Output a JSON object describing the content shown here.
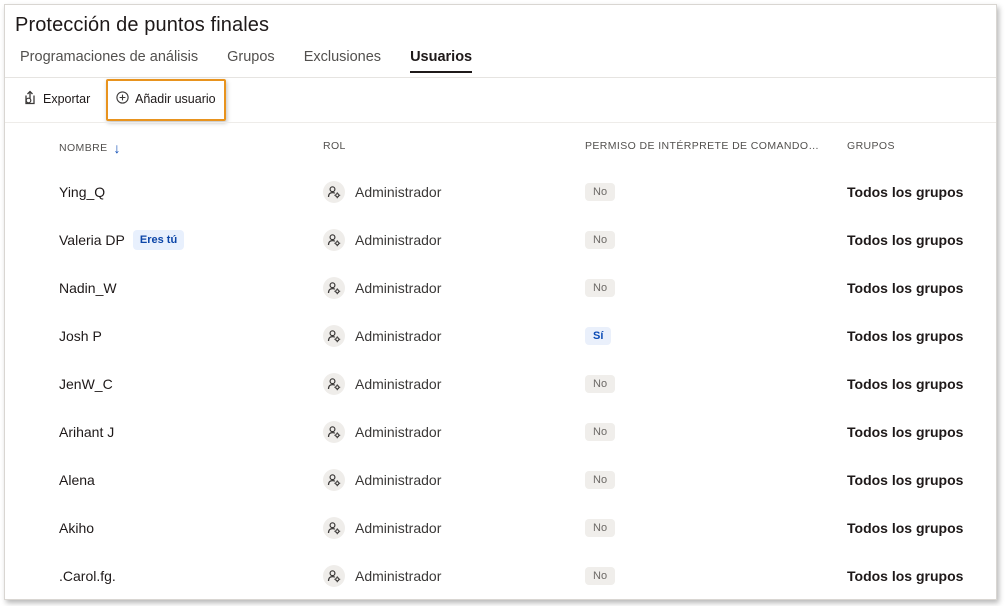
{
  "page": {
    "title": "Protección de puntos finales"
  },
  "tabs": [
    {
      "label": "Programaciones de análisis",
      "active": false
    },
    {
      "label": "Grupos",
      "active": false
    },
    {
      "label": "Exclusiones",
      "active": false
    },
    {
      "label": "Usuarios",
      "active": true
    }
  ],
  "toolbar": {
    "export_label": "Exportar",
    "add_user_label": "Añadir usuario",
    "highlight_color": "#e8931e"
  },
  "table": {
    "columns": {
      "name": "NOMBRE",
      "role": "ROL",
      "permission": "PERMISO DE INTÉRPRETE DE COMANDO…",
      "groups": "GRUPOS"
    },
    "sort_indicator": "↓",
    "rows": [
      {
        "name": "Ying_Q",
        "badge": "",
        "role": "Administrador",
        "permission": "No",
        "groups": "Todos los grupos"
      },
      {
        "name": "Valeria DP",
        "badge": "Eres tú",
        "role": "Administrador",
        "permission": "No",
        "groups": "Todos los grupos"
      },
      {
        "name": "Nadin_W",
        "badge": "",
        "role": "Administrador",
        "permission": "No",
        "groups": "Todos los grupos"
      },
      {
        "name": "Josh P",
        "badge": "",
        "role": "Administrador",
        "permission": "Sí",
        "groups": "Todos los grupos"
      },
      {
        "name": "JenW_C",
        "badge": "",
        "role": "Administrador",
        "permission": "No",
        "groups": "Todos los grupos"
      },
      {
        "name": "Arihant J",
        "badge": "",
        "role": "Administrador",
        "permission": "No",
        "groups": "Todos los grupos"
      },
      {
        "name": "Alena",
        "badge": "",
        "role": "Administrador",
        "permission": "No",
        "groups": "Todos los grupos"
      },
      {
        "name": "Akiho",
        "badge": "",
        "role": "Administrador",
        "permission": "No",
        "groups": "Todos los grupos"
      },
      {
        "name": ".Carol.fg.",
        "badge": "",
        "role": "Administrador",
        "permission": "No",
        "groups": "Todos los grupos"
      }
    ]
  }
}
